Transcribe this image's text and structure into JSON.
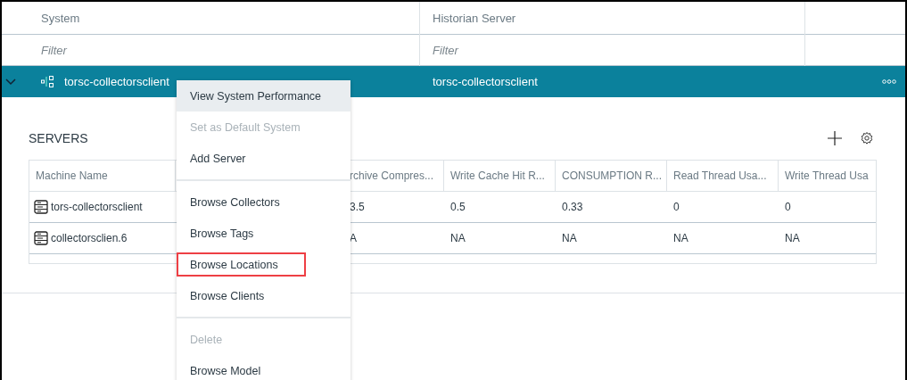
{
  "systems_grid": {
    "columns": [
      "System",
      "Historian Server"
    ],
    "filters": [
      {
        "placeholder": "Filter"
      },
      {
        "placeholder": "Filter"
      }
    ],
    "rows": [
      {
        "system": "torsc-collectorsclient",
        "historian_server": "torsc-collectorsclient",
        "expanded": true,
        "selected": true
      }
    ]
  },
  "servers": {
    "title": "SERVERS",
    "columns": [
      "Machine Name",
      "",
      "rchive Compres...",
      "Write Cache Hit R...",
      "CONSUMPTION R...",
      "Read Thread Usa...",
      "Write Thread Usa"
    ],
    "rows": [
      {
        "cells": [
          "tors-collectorsclient",
          "",
          "3.5",
          "0.5",
          "0.33",
          "0",
          "0"
        ]
      },
      {
        "cells": [
          "collectorsclien.6",
          "",
          "A",
          "NA",
          "NA",
          "NA",
          "NA"
        ]
      }
    ]
  },
  "context_menu": {
    "groups": [
      [
        {
          "label": "View System Performance",
          "hovered": true,
          "disabled": false,
          "outlined": false
        },
        {
          "label": "Set as Default System",
          "hovered": false,
          "disabled": true,
          "outlined": false
        },
        {
          "label": "Add Server",
          "hovered": false,
          "disabled": false,
          "outlined": false
        }
      ],
      [
        {
          "label": "Browse Collectors",
          "hovered": false,
          "disabled": false,
          "outlined": false
        },
        {
          "label": "Browse Tags",
          "hovered": false,
          "disabled": false,
          "outlined": false
        },
        {
          "label": "Browse Locations",
          "hovered": false,
          "disabled": false,
          "outlined": true
        },
        {
          "label": "Browse Clients",
          "hovered": false,
          "disabled": false,
          "outlined": false
        }
      ],
      [
        {
          "label": "Delete",
          "hovered": false,
          "disabled": true,
          "outlined": false
        },
        {
          "label": "Browse Model",
          "hovered": false,
          "disabled": false,
          "outlined": false
        }
      ]
    ]
  }
}
